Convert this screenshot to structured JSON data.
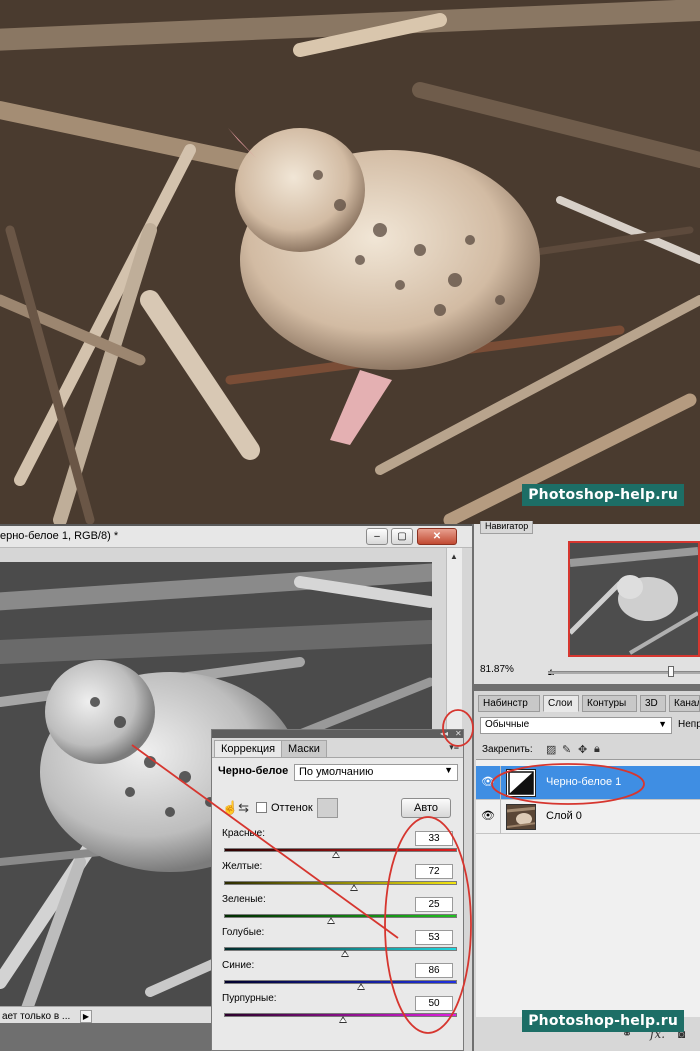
{
  "watermark": "Photoshop-help.ru",
  "document": {
    "title": "ерно-белое 1, RGB/8) *",
    "status_text": "ает только в ...",
    "buttons": {
      "minimize": "–",
      "restore": "▢",
      "close": "✕"
    }
  },
  "adjustments": {
    "tabs": [
      "Коррекция",
      "Маски"
    ],
    "preset_label": "Черно-белое",
    "preset_value": "По умолчанию",
    "tint_label": "Оттенок",
    "auto_label": "Авто",
    "sliders": [
      {
        "label": "Красные:",
        "value": "33",
        "pos": 0.48,
        "gradient": [
          "#2b0000",
          "#e02020"
        ]
      },
      {
        "label": "Желтые:",
        "value": "72",
        "pos": 0.56,
        "gradient": [
          "#2b2b00",
          "#f2e410"
        ]
      },
      {
        "label": "Зеленые:",
        "value": "25",
        "pos": 0.46,
        "gradient": [
          "#002b00",
          "#20c020"
        ]
      },
      {
        "label": "Голубые:",
        "value": "53",
        "pos": 0.52,
        "gradient": [
          "#002b2b",
          "#20d8e0"
        ]
      },
      {
        "label": "Синие:",
        "value": "86",
        "pos": 0.59,
        "gradient": [
          "#00002b",
          "#2030e0"
        ]
      },
      {
        "label": "Пурпурные:",
        "value": "50",
        "pos": 0.51,
        "gradient": [
          "#2b002b",
          "#e020e0"
        ]
      }
    ]
  },
  "navigator": {
    "tab": "Навигатор",
    "zoom": "81.87%"
  },
  "layers": {
    "tabs": [
      "Набинстр",
      "Слои",
      "Контуры",
      "3D",
      "Канал"
    ],
    "blend_mode": "Обычные",
    "opacity_label": "Непр",
    "lock_label": "Закрепить:",
    "items": [
      {
        "name": "Черно-белое 1",
        "selected": true,
        "type": "adjustment"
      },
      {
        "name": "Слой 0",
        "selected": false,
        "type": "image"
      }
    ],
    "footer_icons": [
      "link-icon",
      "fx-icon",
      "mask-icon"
    ]
  },
  "colors": {
    "highlight": "#3f8ee3",
    "annotation": "#d6362f",
    "watermark_bg": "#1d6e66"
  }
}
